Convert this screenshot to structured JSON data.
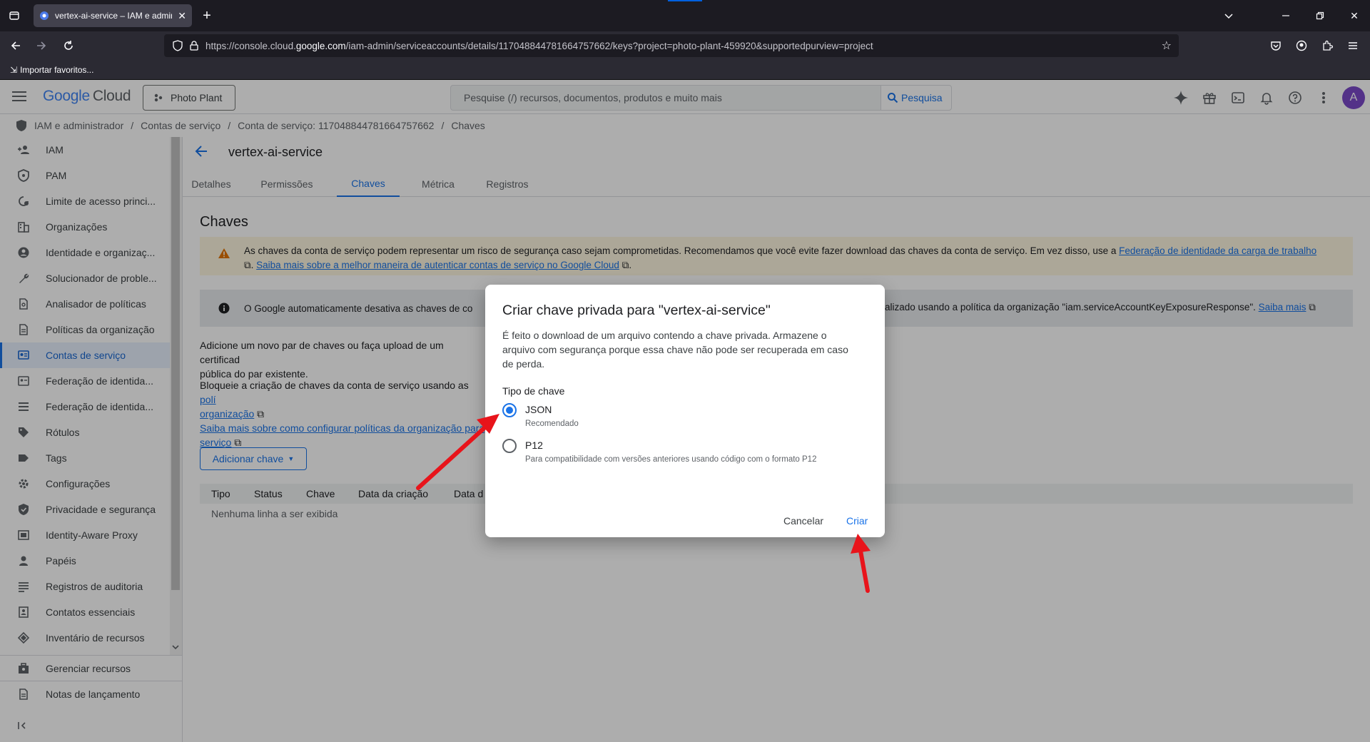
{
  "browser": {
    "tab_title": "vertex-ai-service – IAM e admin",
    "url_prefix": "https://console.cloud.",
    "url_domain": "google.com",
    "url_path": "/iam-admin/serviceaccounts/details/117048844781664757662/keys?project=photo-plant-459920&supportedpurview=project",
    "bookmark_label": "Importar favoritos..."
  },
  "header": {
    "logo_google": "Google",
    "logo_cloud": "Cloud",
    "project": "Photo Plant",
    "search_placeholder": "Pesquise (/) recursos, documentos, produtos e muito mais",
    "search_button": "Pesquisa",
    "avatar_letter": "A"
  },
  "breadcrumb": [
    "IAM e administrador",
    "Contas de serviço",
    "Conta de serviço: 117048844781664757662",
    "Chaves"
  ],
  "sidebar": {
    "items": [
      {
        "label": "IAM",
        "icon": "person-add-icon"
      },
      {
        "label": "PAM",
        "icon": "shield-icon"
      },
      {
        "label": "Limite de acesso princi...",
        "icon": "boundary-icon"
      },
      {
        "label": "Organizações",
        "icon": "building-icon"
      },
      {
        "label": "Identidade e organizaç...",
        "icon": "account-circle-icon"
      },
      {
        "label": "Solucionador de proble...",
        "icon": "wrench-icon"
      },
      {
        "label": "Analisador de políticas",
        "icon": "document-search-icon"
      },
      {
        "label": "Políticas da organização",
        "icon": "document-icon"
      },
      {
        "label": "Contas de serviço",
        "icon": "service-account-icon"
      },
      {
        "label": "Federação de identida...",
        "icon": "federation-icon"
      },
      {
        "label": "Federação de identida...",
        "icon": "list-icon"
      },
      {
        "label": "Rótulos",
        "icon": "label-icon"
      },
      {
        "label": "Tags",
        "icon": "tag-icon"
      },
      {
        "label": "Configurações",
        "icon": "gear-icon"
      },
      {
        "label": "Privacidade e segurança",
        "icon": "privacy-icon"
      },
      {
        "label": "Identity-Aware Proxy",
        "icon": "proxy-icon"
      },
      {
        "label": "Papéis",
        "icon": "roles-icon"
      },
      {
        "label": "Registros de auditoria",
        "icon": "audit-icon"
      },
      {
        "label": "Contatos essenciais",
        "icon": "contacts-icon"
      },
      {
        "label": "Inventário de recursos",
        "icon": "inventory-icon"
      }
    ],
    "active_index": 8,
    "manage_resources": "Gerenciar recursos",
    "release_notes": "Notas de lançamento"
  },
  "main": {
    "title": "vertex-ai-service",
    "tabs": [
      "Detalhes",
      "Permissões",
      "Chaves",
      "Métrica",
      "Registros"
    ],
    "active_tab": 2,
    "section_title": "Chaves",
    "warning_text": "As chaves da conta de serviço podem representar um risco de segurança caso sejam comprometidas. Recomendamos que você evite fazer download das chaves da conta de serviço. Em vez disso, use a ",
    "warning_link1": "Federação de identidade da carga de trabalho",
    "warning_mid": ". ",
    "warning_link2": "Saiba mais sobre a melhor maneira de autenticar contas de serviço no Google Cloud",
    "info_text_left": "O Google automaticamente desativa as chaves de co",
    "info_text_right": "alizado usando a política da organização \"iam.serviceAccountKeyExposureResponse\".",
    "info_link": "Saiba mais",
    "para1": "Adicione um novo par de chaves ou faça upload de um certificad",
    "para1b": "pública do par existente.",
    "para2": "Bloqueie a criação de chaves da conta de serviço usando as ",
    "para2_link1": "polí",
    "para2_link1b": "organização",
    "para2_link2": "Saiba mais sobre como configurar políticas da organização para",
    "para2_link2b": "serviço",
    "add_key": "Adicionar chave",
    "table_headers": [
      "Tipo",
      "Status",
      "Chave",
      "Data da criação",
      "Data d"
    ],
    "table_empty": "Nenhuma linha a ser exibida"
  },
  "dialog": {
    "title": "Criar chave privada para \"vertex-ai-service\"",
    "description": "É feito o download de um arquivo contendo a chave privada. Armazene o arquivo com segurança porque essa chave não pode ser recuperada em caso de perda.",
    "key_type_label": "Tipo de chave",
    "options": [
      {
        "label": "JSON",
        "sub": "Recomendado",
        "checked": true
      },
      {
        "label": "P12",
        "sub": "Para compatibilidade com versões anteriores usando código com o formato P12",
        "checked": false
      }
    ],
    "cancel": "Cancelar",
    "create": "Criar"
  },
  "colors": {
    "accent": "#1a73e8",
    "annotation_arrow": "#e8141b",
    "warning_bg": "#fef7e0",
    "avatar": "#7b49c9"
  }
}
